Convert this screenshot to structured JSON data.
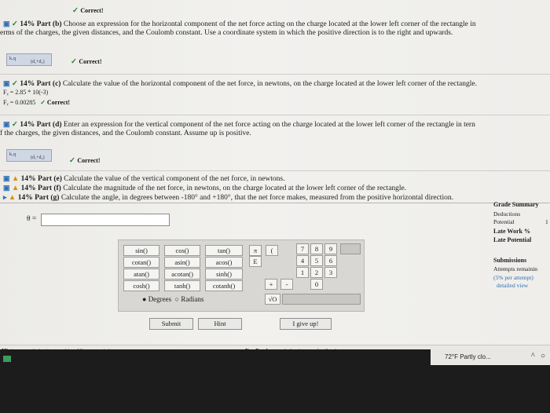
{
  "partA": {
    "status": "Correct!"
  },
  "partB": {
    "label": "14% Part (b)",
    "text1": "Choose an expression for the horizontal component of the net force acting on the charge located at the lower left corner of the rectangle in",
    "text2": "erms of the charges, the given distances, and the Coulomb constant. Use a coordinate system in which the positive direction is to the right and upwards.",
    "status": "Correct!"
  },
  "partC": {
    "label": "14% Part (c)",
    "text": "Calculate the value of the horizontal component of the net force, in newtons, on the charge located at the lower left corner of the rectangle.",
    "line1": "Fᵪ = 2.85 * 10(-3)",
    "line2": "Fᵪ = 0.00285",
    "status": "Correct!"
  },
  "partD": {
    "label": "14% Part (d)",
    "text1": "Enter an expression for the vertical component of the net force acting on the charge located at the lower left corner of the rectangle in tern",
    "text2": "f the charges, the given distances, and the Coulomb constant. Assume up is positive.",
    "status": "Correct!"
  },
  "partE": {
    "label": "14% Part (e)",
    "text": "Calculate the value of the vertical component of the net force, in newtons."
  },
  "partF": {
    "label": "14% Part (f)",
    "text": "Calculate the magnitude of the net force, in newtons, on the charge located at the lower left corner of the rectangle."
  },
  "partG": {
    "label": "14% Part (g)",
    "text": "Calculate the angle, in degrees between -180° and +180°, that the net force makes, measured from the positive horizontal direction."
  },
  "answer": {
    "label": "θ =",
    "value": ""
  },
  "keyboard": {
    "functions": [
      [
        "sin()",
        "cos()",
        "tan()"
      ],
      [
        "cotan()",
        "asin()",
        "acos()"
      ],
      [
        "atan()",
        "acotan()",
        "sinh()"
      ],
      [
        "cosh()",
        "tanh()",
        "cotanh()"
      ]
    ],
    "mode_degrees": "Degrees",
    "mode_radians": "Radians",
    "pi": "π",
    "open_paren": "(",
    "e": "E",
    "digits": [
      [
        "7",
        "8",
        "9"
      ],
      [
        "4",
        "5",
        "6"
      ],
      [
        "1",
        "2",
        "3"
      ],
      [
        "0"
      ]
    ],
    "plus": "+",
    "minus": "-",
    "sqrt": "√O"
  },
  "buttons": {
    "submit": "Submit",
    "hint": "Hint",
    "give_up": "I give up!"
  },
  "sidebar": {
    "grade_summary": "Grade Summary",
    "deductions": "Deductions",
    "potential": "Potential",
    "late_work": "Late Work %",
    "late_potential": "Late Potential",
    "submissions": "Submissions",
    "attempts": "Attempts remainin",
    "per_attempt": "(5% per attempt)",
    "detailed_view": "detailed view",
    "potential_value": "1"
  },
  "footer": {
    "hints": "Hints:",
    "hints_text": "deduction per hint. Hints remaining:",
    "feedback": "Feedback:",
    "feedback_text": "deduction per feedback"
  },
  "taskbar": {
    "weather": "72°F  Partly clo..."
  },
  "colors": {
    "correct": "#2e7d32",
    "warning": "#e68a00",
    "formula": "#cfd7e4"
  }
}
